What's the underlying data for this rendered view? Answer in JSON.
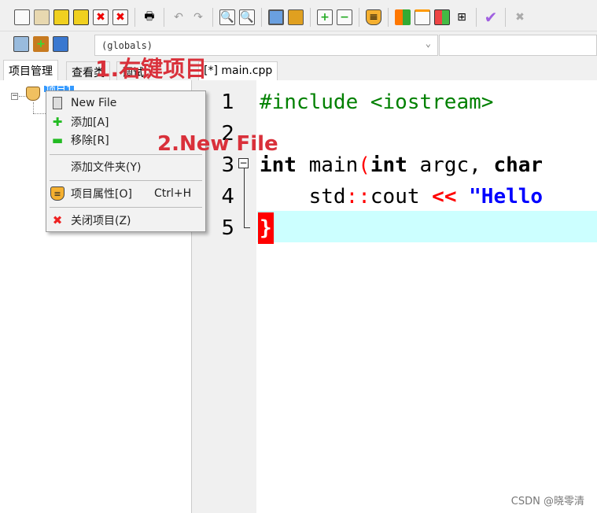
{
  "toolbar1": {
    "icons": [
      "new-icon",
      "open-icon",
      "save-icon",
      "save-all-icon",
      "close-icon",
      "close-all-icon",
      "print-icon",
      "undo-icon",
      "redo-icon",
      "find-icon",
      "replace-icon",
      "toggle-view-icon",
      "goto-icon",
      "add-to-project-icon",
      "remove-from-project-icon",
      "project-options-icon",
      "compile-icon",
      "window-icon",
      "run-icon",
      "grid-icon",
      "check-icon",
      "stop-icon"
    ]
  },
  "toolbar2": {
    "icons": [
      "new-project-icon",
      "add-file-icon",
      "book-icon"
    ],
    "scope_combo": "(globals)"
  },
  "tabs": {
    "left": [
      "项目管理",
      "查看类",
      "调试"
    ],
    "editor": "[*] main.cpp"
  },
  "tree": {
    "project": "项目1"
  },
  "annotations": {
    "step1": "1.右键项目",
    "step2": "2.New File"
  },
  "context_menu": {
    "items": [
      {
        "label": "New File",
        "icon": "new-file-icon"
      },
      {
        "label": "添加[A]",
        "icon": "add-icon"
      },
      {
        "label": "移除[R]",
        "icon": "remove-icon"
      },
      {
        "label": "添加文件夹(Y)"
      },
      {
        "label": "项目属性[O]",
        "shortcut": "Ctrl+H",
        "icon": "project-properties-icon"
      },
      {
        "label": "关闭项目(Z)",
        "icon": "close-project-icon"
      }
    ]
  },
  "editor": {
    "line_numbers": [
      "1",
      "2",
      "3",
      "4",
      "5"
    ],
    "lines": {
      "l1": "#include <iostream>",
      "l3a": "int",
      " l3b": " main",
      "l3c": "(",
      "l3d": "int",
      "l3e": " argc, ",
      "l3f": "char",
      "l4a": "    std",
      "l4b": "::",
      "l4c": "cout ",
      "l4d": "<<",
      "l4e": " \"Hello",
      "l5": "}"
    },
    "colors": {
      "preprocessor": "#008000",
      "keyword": "#000000",
      "operator": "#ff0000",
      "string": "#0000ff",
      "current_line": "#ccffff"
    }
  },
  "watermark": "CSDN @晓零清"
}
